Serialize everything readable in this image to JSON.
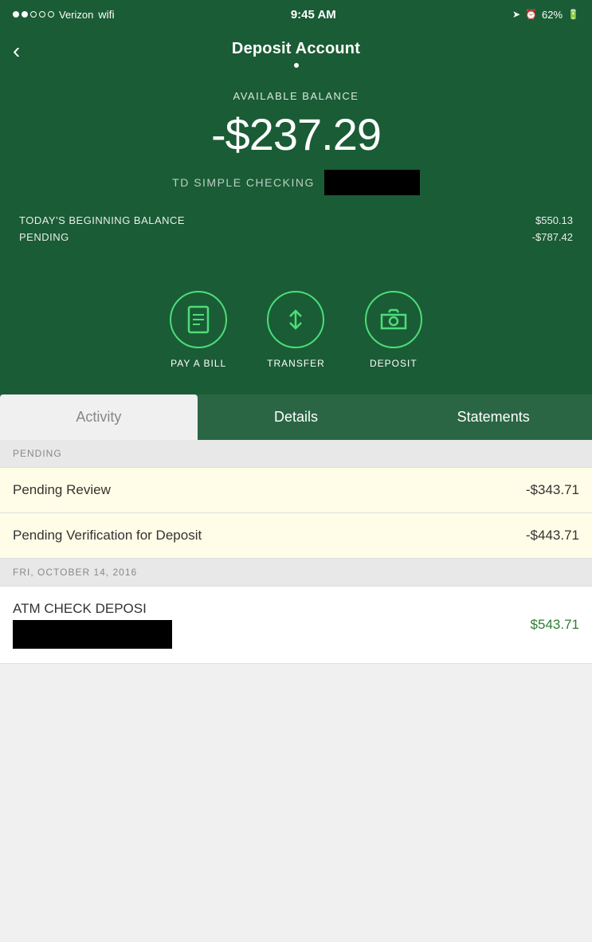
{
  "status_bar": {
    "carrier": "Verizon",
    "time": "9:45 AM",
    "battery": "62%"
  },
  "header": {
    "back_label": "‹",
    "title": "Deposit Account"
  },
  "balance": {
    "available_balance_label": "AVAILABLE BALANCE",
    "amount": "-$237.29",
    "account_name": "TD SIMPLE CHECKING",
    "today_beginning_balance_label": "TODAY'S BEGINNING BALANCE",
    "today_beginning_balance_value": "$550.13",
    "pending_label": "PENDING",
    "pending_value": "-$787.42"
  },
  "actions": [
    {
      "id": "pay-bill",
      "label": "PAY A BILL",
      "icon": "📄"
    },
    {
      "id": "transfer",
      "label": "TRANSFER",
      "icon": "⇅"
    },
    {
      "id": "deposit",
      "label": "DEPOSIT",
      "icon": "📷"
    }
  ],
  "tabs": [
    {
      "id": "activity",
      "label": "Activity",
      "active": true
    },
    {
      "id": "details",
      "label": "Details",
      "active": false
    },
    {
      "id": "statements",
      "label": "Statements",
      "active": false
    }
  ],
  "pending_section": {
    "header": "PENDING",
    "transactions": [
      {
        "label": "Pending Review",
        "amount": "-$343.71"
      },
      {
        "label": "Pending Verification for Deposit",
        "amount": "-$443.71"
      }
    ]
  },
  "dated_section": {
    "header": "FRI, OCTOBER 14, 2016",
    "transactions": [
      {
        "label": "ATM CHECK DEPOSI",
        "amount": "$543.71"
      }
    ]
  }
}
